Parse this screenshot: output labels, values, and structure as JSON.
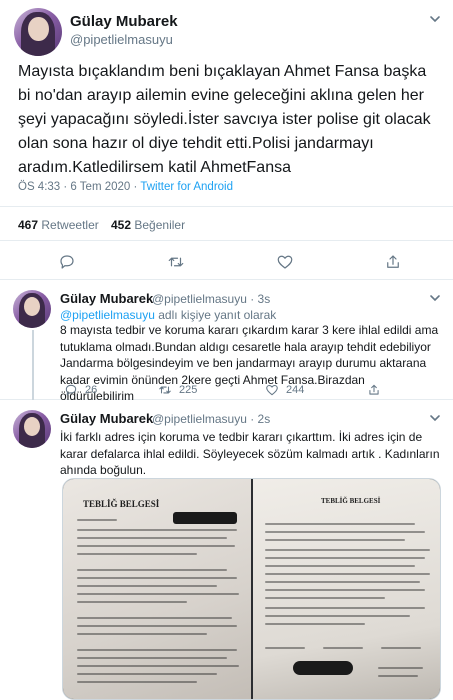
{
  "main_tweet": {
    "name": "Gülay Mubarek",
    "handle": "@pipetlielmasuyu",
    "text": "Mayısta bıçaklandım beni bıçaklayan Ahmet Fansa başka bi no'dan arayıp ailemin evine geleceğini aklına gelen her şeyi yapacağını söyledi.İster savcıya ister polise git olacak olan sona hazır ol diye tehdit etti.Polisi jandarmayı aradım.Katledilirsem katil AhmetFansa",
    "time": "ÖS 4:33 · 6 Tem 2020 ·",
    "source": "Twitter for Android",
    "retweets": "467",
    "retweets_label": "Retweetler",
    "likes": "452",
    "likes_label": "Beğeniler"
  },
  "reply1": {
    "name": "Gülay Mubarek",
    "handle": "@pipetlielmasuyu · 3s",
    "reply_to_mention": "@pipetlielmasuyu",
    "reply_to_suffix": " adlı kişiye yanıt olarak",
    "text": "8 mayısta tedbir ve koruma kararı çıkardım karar 3 kere ihlal edildi ama tutuklama olmadı.Bundan aldıgı cesaretle hala arayıp tehdit edebiliyor Jandarma bölgesindeyim ve ben jandarmayı arayıp durumu aktarana kadar evimin önünden 2kere geçti Ahmet Fansa.Birazdan öldürülebilirim",
    "replies": "26",
    "retweets": "225",
    "likes": "244"
  },
  "reply2": {
    "name": "Gülay Mubarek",
    "handle": "@pipetlielmasuyu · 2s",
    "text": "İki farklı adres için koruma ve tedbir kararı çıkarttım.  İki adres için de karar defalarca ihlal edildi. Söyleyecek sözüm kalmadı artık . Kadınların ahında boğulun."
  },
  "media": {
    "left_doc_title": "TEBLİĞ BELGESİ",
    "right_doc_title": "TEBLİĞ BELGESİ"
  },
  "colors": {
    "accent": "#1da1f2",
    "muted": "#657786",
    "text": "#14171a",
    "border": "#e6ecf0"
  },
  "icons": [
    "chevron-down-icon",
    "reply-icon",
    "retweet-icon",
    "like-icon",
    "share-icon"
  ]
}
